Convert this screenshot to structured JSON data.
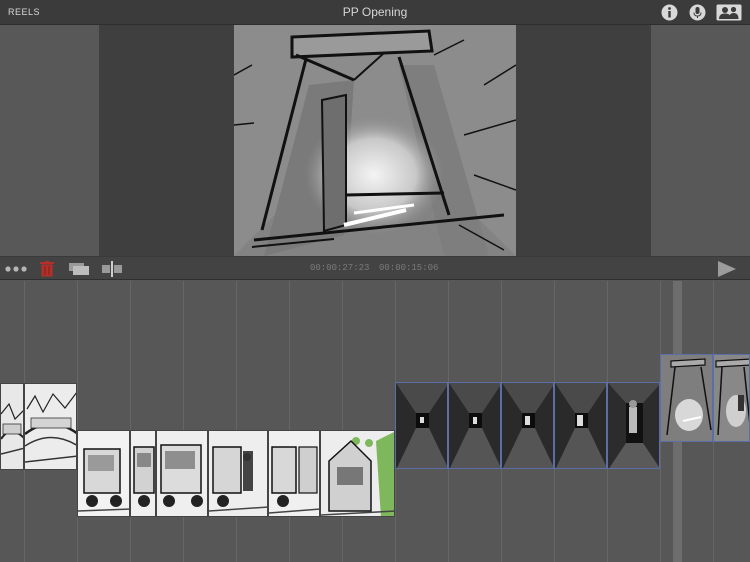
{
  "topbar": {
    "reels_label": "REELS",
    "title": "PP Opening",
    "icons": [
      "info-icon",
      "microphone-icon",
      "people-icon"
    ]
  },
  "transport": {
    "icons": [
      "more-icon",
      "trash-icon",
      "duplicate-icon",
      "split-icon",
      "play-icon"
    ],
    "timecode_position": "00:00:27:23",
    "timecode_duration": "00:00:15:06"
  },
  "colors": {
    "topbar": "#3b3b3b",
    "background": "#585858",
    "trash": "#b3302a",
    "clip_border_selected": "#5b6ea8"
  },
  "timeline": {
    "clips": [
      {
        "name": "clip-rooftops-1",
        "style": "sketch-light"
      },
      {
        "name": "clip-rooftops-2",
        "style": "sketch-light"
      },
      {
        "name": "clip-vehicle-1",
        "style": "sketch-white"
      },
      {
        "name": "clip-vehicle-2",
        "style": "sketch-white"
      },
      {
        "name": "clip-vehicle-3",
        "style": "sketch-white"
      },
      {
        "name": "clip-vehicle-4",
        "style": "sketch-white"
      },
      {
        "name": "clip-vehicle-5",
        "style": "sketch-white"
      },
      {
        "name": "clip-vehicle-6",
        "style": "sketch-green"
      },
      {
        "name": "clip-corridor-1",
        "style": "dark"
      },
      {
        "name": "clip-corridor-2",
        "style": "dark"
      },
      {
        "name": "clip-corridor-3",
        "style": "dark"
      },
      {
        "name": "clip-corridor-4",
        "style": "dark"
      },
      {
        "name": "clip-corridor-5",
        "style": "dark"
      },
      {
        "name": "clip-doorway-1",
        "style": "gray"
      },
      {
        "name": "clip-doorway-2",
        "style": "gray"
      }
    ]
  }
}
